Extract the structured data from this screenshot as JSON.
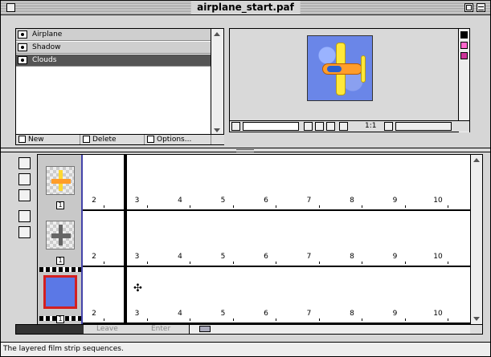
{
  "window": {
    "title": "airplane_start.paf"
  },
  "layers": [
    {
      "name": "Airplane",
      "selected": false
    },
    {
      "name": "Shadow",
      "selected": false
    },
    {
      "name": "Clouds",
      "selected": true
    }
  ],
  "layer_buttons": {
    "new": "New",
    "delete": "Delete",
    "options": "Options..."
  },
  "preview": {
    "ratio": "1:1",
    "swatch_colors": [
      "#000000",
      "#ff66cc",
      "#cc3399"
    ]
  },
  "timeline": {
    "frame_numbers": [
      "2",
      "3",
      "4",
      "5",
      "6",
      "7",
      "8",
      "9",
      "10"
    ],
    "track_badges": [
      "1",
      "1",
      "1"
    ],
    "leave_label": "Leave",
    "enter_label": "Enter"
  },
  "status": {
    "text": "The layered film strip sequences."
  }
}
